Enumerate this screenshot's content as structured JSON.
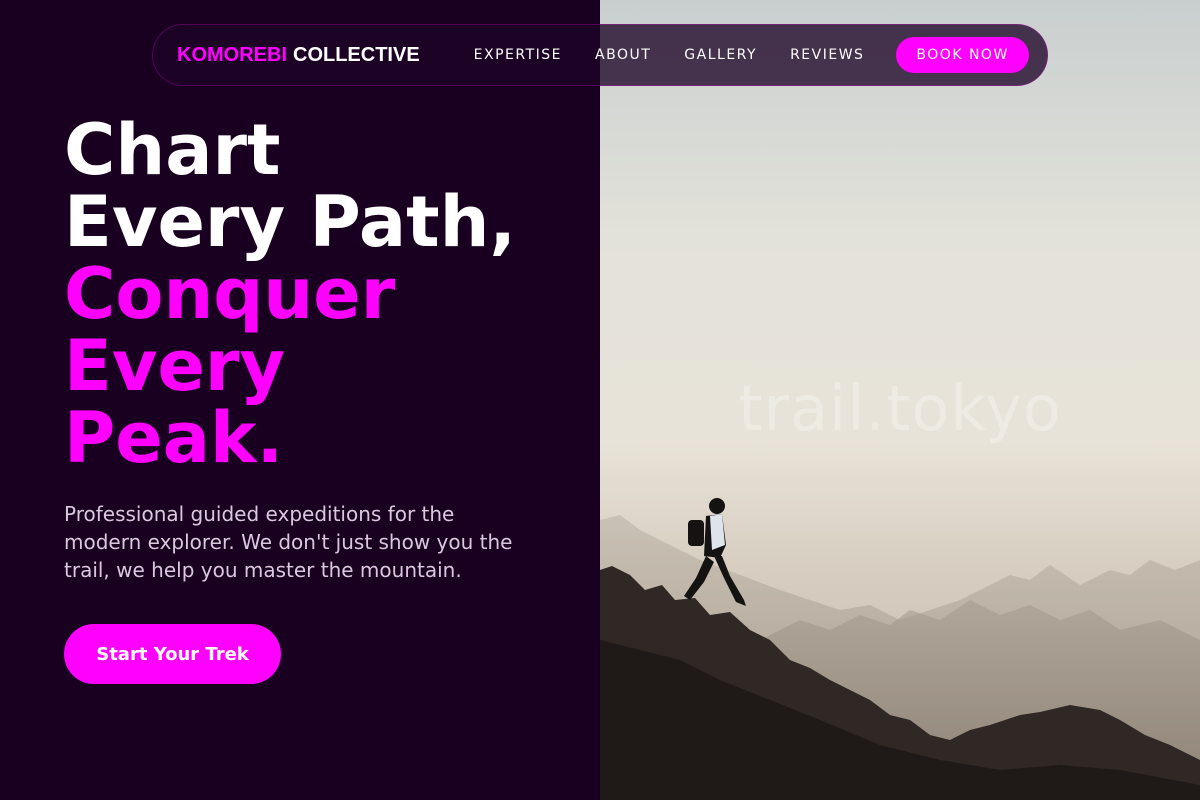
{
  "nav": {
    "brand_accent": "KOMOREBI",
    "brand_rest": "COLLECTIVE",
    "links": [
      "EXPERTISE",
      "ABOUT",
      "GALLERY",
      "REVIEWS"
    ],
    "cta_label": "BOOK NOW"
  },
  "hero": {
    "headline_white": [
      "Chart",
      "Every Path,"
    ],
    "headline_accent": [
      "Conquer",
      "Every",
      "Peak."
    ],
    "subtitle": "Professional guided expeditions for the modern explorer. We don't just show you the trail, we help you master the mountain.",
    "cta_label": "Start Your Trek"
  },
  "photo": {
    "watermark": "trail.tokyo",
    "subject": "hiker descending rocky mountain ridge"
  },
  "colors": {
    "background": "#1a0020",
    "accent": "#ff00ff",
    "text": "#ffffff",
    "muted_text": "#d9c9de"
  }
}
